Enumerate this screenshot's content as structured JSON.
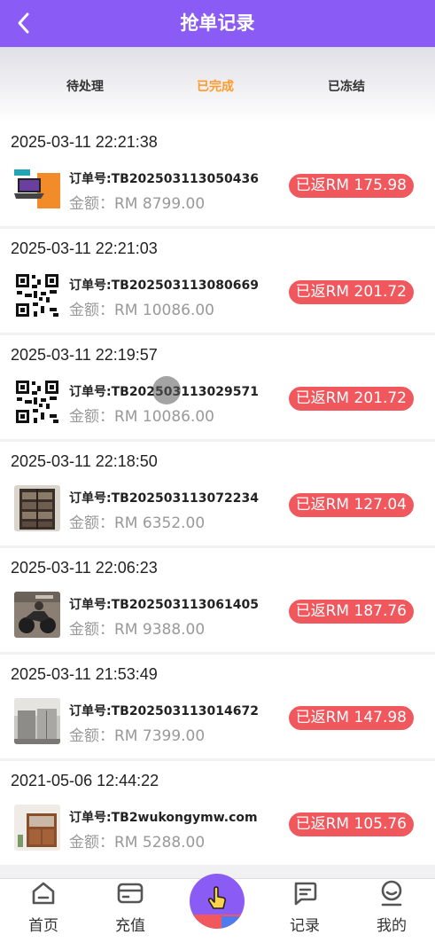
{
  "header": {
    "title": "抢单记录"
  },
  "tabs": [
    {
      "label": "待处理"
    },
    {
      "label": "已完成"
    },
    {
      "label": "已冻结"
    }
  ],
  "orders": [
    {
      "time": "2025-03-11 22:21:38",
      "order_no": "订单号:TB202503113050436",
      "amount": "金额：RM 8799.00",
      "rebate": "已返RM 175.98",
      "image": "laptop"
    },
    {
      "time": "2025-03-11 22:21:03",
      "order_no": "订单号:TB202503113080669",
      "amount": "金额：RM 10086.00",
      "rebate": "已返RM 201.72",
      "image": "qr-code"
    },
    {
      "time": "2025-03-11 22:19:57",
      "order_no": "订单号:TB202503113029571",
      "amount": "金额：RM 10086.00",
      "rebate": "已返RM 201.72",
      "image": "qr-code"
    },
    {
      "time": "2025-03-11 22:18:50",
      "order_no": "订单号:TB202503113072234",
      "amount": "金额：RM 6352.00",
      "rebate": "已返RM 127.04",
      "image": "bookshelf"
    },
    {
      "time": "2025-03-11 22:06:23",
      "order_no": "订单号:TB202503113061405",
      "amount": "金额：RM 9388.00",
      "rebate": "已返RM 187.76",
      "image": "motorcycle"
    },
    {
      "time": "2025-03-11 21:53:49",
      "order_no": "订单号:TB202503113014672",
      "amount": "金额：RM 7399.00",
      "rebate": "已返RM 147.98",
      "image": "refrigerator"
    },
    {
      "time": "2021-05-06 12:44:22",
      "order_no": "订单号:TB2wukongymw.com",
      "amount": "金额：RM 5288.00",
      "rebate": "已返RM 105.76",
      "image": "cabinet"
    }
  ],
  "tabbar": {
    "home": "首页",
    "recharge": "充值",
    "records": "记录",
    "mine": "我的"
  },
  "colors": {
    "accent": "#8a5cf5",
    "active_tab": "#ff9a2a",
    "badge": "#f0585d"
  }
}
